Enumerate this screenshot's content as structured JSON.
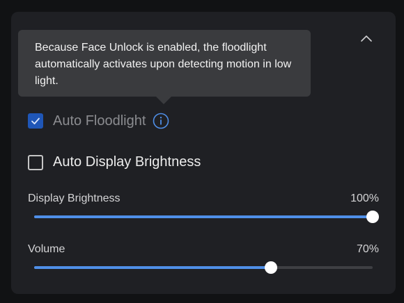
{
  "colors": {
    "accent": "#4f8fe8",
    "checkbox_checked": "#1f56b7",
    "panel_bg": "#1f2024",
    "tooltip_bg": "#3a3b3e"
  },
  "tooltip": {
    "text": "Because Face Unlock is enabled, the floodlight automatically activates upon detecting motion in low light."
  },
  "header": {
    "collapse_icon": "chevron-up-icon"
  },
  "options": {
    "auto_floodlight": {
      "label": "Auto Floodlight",
      "checked": true,
      "disabled": true,
      "info_icon": "info-icon"
    },
    "auto_display_brightness": {
      "label": "Auto Display Brightness",
      "checked": false
    }
  },
  "sliders": {
    "display_brightness": {
      "label": "Display Brightness",
      "value_text": "100%",
      "value": 100
    },
    "volume": {
      "label": "Volume",
      "value_text": "70%",
      "value": 70
    }
  }
}
